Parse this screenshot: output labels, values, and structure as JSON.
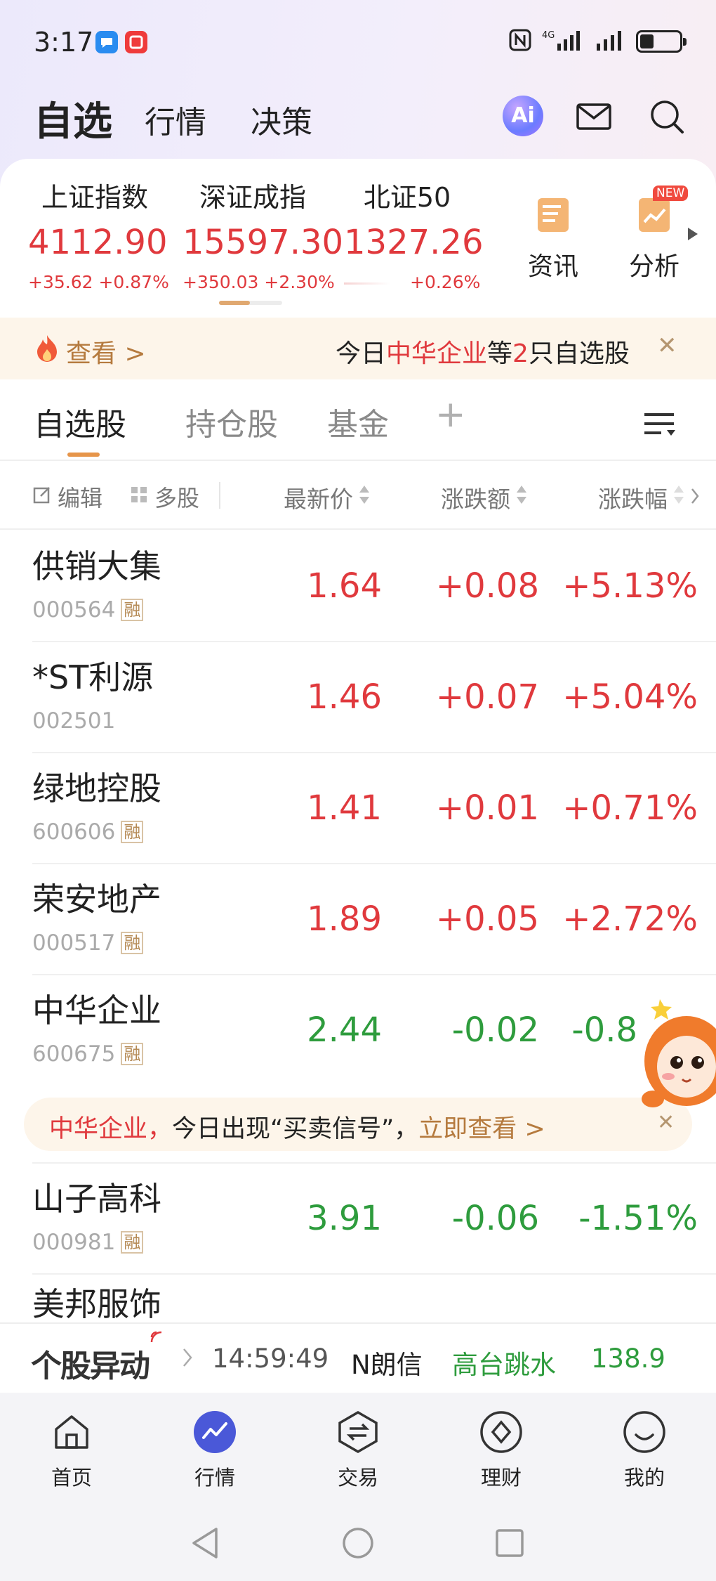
{
  "status_bar": {
    "time": "3:17",
    "network_label": "4G",
    "battery_level": 0.35
  },
  "header": {
    "tabs": [
      {
        "label": "自选",
        "active": true
      },
      {
        "label": "行情",
        "active": false
      },
      {
        "label": "决策",
        "active": false
      }
    ],
    "ai_label": "Ai",
    "icons": [
      "ai-icon",
      "mail-icon",
      "search-icon"
    ]
  },
  "indices": [
    {
      "name": "上证指数",
      "value": "4112.90",
      "change": "+35.62 +0.87%"
    },
    {
      "name": "深证成指",
      "value": "15597.30",
      "change": "+350.03 +2.30%"
    },
    {
      "name": "北证50",
      "value": "1327.26",
      "change": "+0.26%"
    }
  ],
  "index_buttons": [
    {
      "label": "资讯",
      "icon": "news-icon"
    },
    {
      "label": "分析",
      "icon": "analysis-icon",
      "badge": "NEW"
    }
  ],
  "promo": {
    "view_label": "查看 >",
    "text_prefix": "今日",
    "text_highlight": "中华企业",
    "text_mid": "等",
    "text_count": "2",
    "text_suffix": "只自选股"
  },
  "list_tabs": [
    {
      "label": "自选股",
      "active": true
    },
    {
      "label": "持仓股",
      "active": false
    },
    {
      "label": "基金",
      "active": false
    }
  ],
  "add_tab_label": "+",
  "toolbar": {
    "edit_label": "编辑",
    "multi_label": "多股"
  },
  "columns": {
    "price": "最新价",
    "change": "涨跌额",
    "percent": "涨跌幅"
  },
  "margin_tag": "融",
  "stocks": [
    {
      "name": "供销大集",
      "code": "000564",
      "margin": true,
      "price": "1.64",
      "change": "+0.08",
      "percent": "+5.13%",
      "trend": "up"
    },
    {
      "name": "*ST利源",
      "code": "002501",
      "margin": false,
      "price": "1.46",
      "change": "+0.07",
      "percent": "+5.04%",
      "trend": "up"
    },
    {
      "name": "绿地控股",
      "code": "600606",
      "margin": true,
      "price": "1.41",
      "change": "+0.01",
      "percent": "+0.71%",
      "trend": "up"
    },
    {
      "name": "荣安地产",
      "code": "000517",
      "margin": true,
      "price": "1.89",
      "change": "+0.05",
      "percent": "+2.72%",
      "trend": "up"
    },
    {
      "name": "中华企业",
      "code": "600675",
      "margin": true,
      "price": "2.44",
      "change": "-0.02",
      "percent": "-0.8",
      "trend": "down"
    },
    {
      "name": "山子高科",
      "code": "000981",
      "margin": true,
      "price": "3.91",
      "change": "-0.06",
      "percent": "-1.51%",
      "trend": "down"
    },
    {
      "name": "美邦服饰",
      "code": "",
      "margin": false,
      "price": "",
      "change": "",
      "percent": "",
      "trend": "down"
    }
  ],
  "inline_banner": {
    "stock": "中华企业，",
    "text": "今日出现“买卖信号”，",
    "action": "立即查看 >"
  },
  "ticker": {
    "title": "个股异动",
    "time": "14:59:49",
    "stock": "N朗信",
    "event": "高台跳水",
    "value": "138.9"
  },
  "bottom_nav": [
    {
      "label": "首页",
      "icon": "home-icon",
      "active": false
    },
    {
      "label": "行情",
      "icon": "market-icon",
      "active": true
    },
    {
      "label": "交易",
      "icon": "trade-icon",
      "active": false
    },
    {
      "label": "理财",
      "icon": "wealth-icon",
      "active": false
    },
    {
      "label": "我的",
      "icon": "profile-icon",
      "active": false
    }
  ],
  "colors": {
    "up": "#e0393d",
    "down": "#2e9c3d",
    "accent": "#e6954a",
    "gold": "#b57a3e"
  }
}
